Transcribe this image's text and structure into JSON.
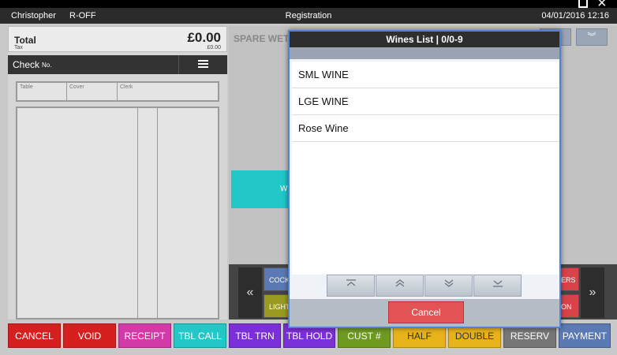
{
  "header": {
    "operator": "Christopher",
    "mode": "R-OFF",
    "title": "Registration",
    "datetime": "04/01/2016 12:16"
  },
  "order": {
    "total_label": "Total",
    "total_value": "£0.00",
    "tax_label": "Tax",
    "tax_value": "£0.00",
    "check_label": "Check",
    "check_no_label": "No.",
    "table_label": "Table",
    "cover_label": "Cover",
    "clerk_label": "Clerk"
  },
  "right_panel": {
    "title": "SPARE WET",
    "teal_button": "W",
    "mini_buttons": [
      "COCK",
      "LIGHT",
      "ERS",
      "ON"
    ]
  },
  "dialog": {
    "title": "Wines List | 0/0-9",
    "items": [
      "SML WINE",
      "LGE WINE",
      "Rose Wine"
    ],
    "cancel_label": "Cancel"
  },
  "function_bar": [
    {
      "label": "CANCEL",
      "color": "#d62020"
    },
    {
      "label": "VOID",
      "color": "#d62020"
    },
    {
      "label": "RECEIPT",
      "color": "#d23aa7"
    },
    {
      "label": "TBL CALL",
      "color": "#22c7c7"
    },
    {
      "label": "TBL TRN",
      "color": "#7b2fd6"
    },
    {
      "label": "TBL HOLD",
      "color": "#7b2fd6"
    },
    {
      "label": "CUST #",
      "color": "#6f9a22"
    },
    {
      "label": "HALF",
      "color": "#e8b21a"
    },
    {
      "label": "DOUBLE",
      "color": "#e8b21a"
    },
    {
      "label": "RESERV",
      "color": "#777777"
    },
    {
      "label": "PAYMENT",
      "color": "#5b79b4"
    }
  ],
  "icons": {
    "pager_first": "double-up-bar-icon",
    "pager_prev": "chevron-up-icon",
    "pager_next": "chevron-down-icon",
    "pager_last": "double-down-bar-icon",
    "scroll_left": "double-chevron-left-icon",
    "scroll_right": "double-chevron-right-icon"
  }
}
